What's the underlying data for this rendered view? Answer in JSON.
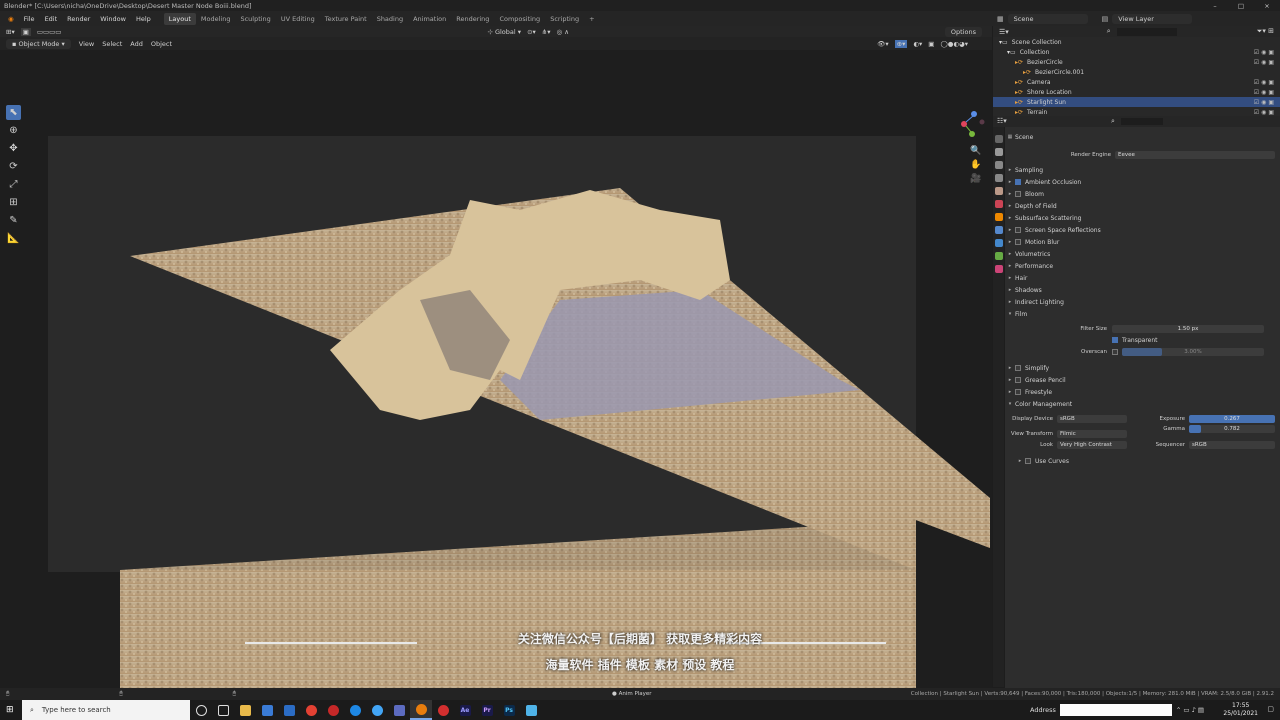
{
  "window": {
    "title": "Blender* [C:\\Users\\nicha\\OneDrive\\Desktop\\Desert Master Node Boiii.blend]",
    "controls": [
      "–",
      "□",
      "×"
    ]
  },
  "menu": {
    "items": [
      "File",
      "Edit",
      "Render",
      "Window",
      "Help"
    ],
    "workspaces": [
      "Layout",
      "Modeling",
      "Sculpting",
      "UV Editing",
      "Texture Paint",
      "Shading",
      "Animation",
      "Rendering",
      "Compositing",
      "Scripting"
    ],
    "add_tab": "+",
    "scene": "Scene",
    "view_layer": "View Layer"
  },
  "viewport_header": {
    "mode": "Object Mode",
    "menus": [
      "View",
      "Select",
      "Add",
      "Object"
    ],
    "orientation": "Global",
    "options": "Options"
  },
  "outliner": {
    "search_placeholder": "",
    "rows": [
      {
        "label": "Scene Collection",
        "indent": 0,
        "selected": false
      },
      {
        "label": "Collection",
        "indent": 1,
        "selected": false
      },
      {
        "label": "BezierCircle",
        "indent": 2,
        "selected": false
      },
      {
        "label": "BezierCircle.001",
        "indent": 3,
        "selected": false
      },
      {
        "label": "Camera",
        "indent": 2,
        "selected": false
      },
      {
        "label": "Shore Location",
        "indent": 2,
        "selected": false
      },
      {
        "label": "Starlight Sun",
        "indent": 2,
        "selected": true
      },
      {
        "label": "Terrain",
        "indent": 2,
        "selected": false
      }
    ]
  },
  "properties": {
    "scene_label": "Scene",
    "render_engine_label": "Render Engine",
    "render_engine": "Eevee",
    "panels": [
      {
        "label": "Sampling",
        "check": false,
        "checked": false
      },
      {
        "label": "Ambient Occlusion",
        "check": true,
        "checked": true
      },
      {
        "label": "Bloom",
        "check": true,
        "checked": false
      },
      {
        "label": "Depth of Field",
        "check": false,
        "checked": false
      },
      {
        "label": "Subsurface Scattering",
        "check": false,
        "checked": false
      },
      {
        "label": "Screen Space Reflections",
        "check": true,
        "checked": false
      },
      {
        "label": "Motion Blur",
        "check": true,
        "checked": false
      },
      {
        "label": "Volumetrics",
        "check": false,
        "checked": false
      },
      {
        "label": "Performance",
        "check": false,
        "checked": false
      },
      {
        "label": "Hair",
        "check": false,
        "checked": false
      },
      {
        "label": "Shadows",
        "check": false,
        "checked": false
      },
      {
        "label": "Indirect Lighting",
        "check": false,
        "checked": false
      },
      {
        "label": "Film",
        "check": false,
        "checked": false
      }
    ],
    "film": {
      "filter_size_label": "Filter Size",
      "filter_size": "1.50 px",
      "transparent_label": "Transparent",
      "overscan_label": "Overscan",
      "overscan": "3.00%"
    },
    "panels2": [
      "Simplify",
      "Grease Pencil",
      "Freestyle",
      "Color Management"
    ],
    "color_management": {
      "display_device_label": "Display Device",
      "display_device": "sRGB",
      "view_transform_label": "View Transform",
      "view_transform": "Filmic",
      "look_label": "Look",
      "look": "Very High Contrast",
      "exposure_label": "Exposure",
      "exposure": "0.267",
      "gamma_label": "Gamma",
      "gamma": "0.782",
      "sequencer_label": "Sequencer",
      "sequencer": "sRGB",
      "use_curves_label": "Use Curves"
    }
  },
  "subtitles": {
    "line1": "关注微信公众号【后期菌】 获取更多精彩内容",
    "line2": "海量软件 插件 模板 素材 预设 教程"
  },
  "statusbar": {
    "center": "Anim Player",
    "stats": "Collection | Starlight Sun | Verts:90,649 | Faces:90,000 | Tris:180,000 | Objects:1/5 | Memory: 281.0 MiB | VRAM: 2.5/8.0 GiB | 2.91.2"
  },
  "taskbar": {
    "search_placeholder": "Type here to search",
    "address_label": "Address",
    "time": "17:55",
    "date": "25/01/2021"
  },
  "colors": {
    "accent": "#4772b3",
    "selected_row": "#334d80",
    "terrain": "#c9b291"
  }
}
